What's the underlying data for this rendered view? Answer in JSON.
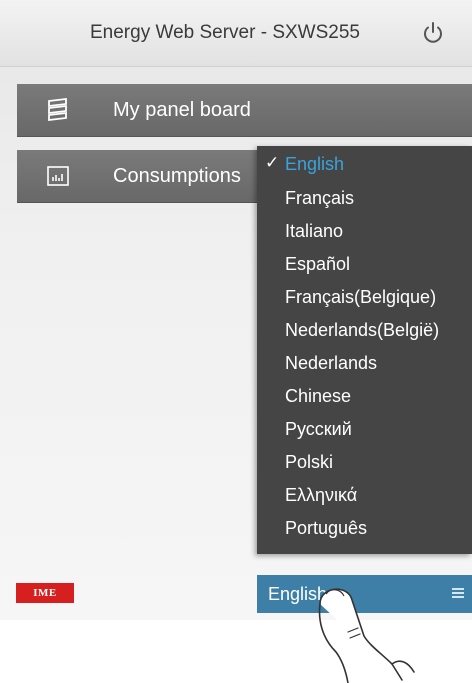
{
  "header": {
    "title": "Energy Web Server - SXWS255",
    "power_icon": "power-icon"
  },
  "menu": {
    "items": [
      {
        "label": "My panel board",
        "icon": "panel-board-icon"
      },
      {
        "label": "Consumptions",
        "icon": "bar-chart-icon"
      }
    ]
  },
  "language_menu": {
    "options": [
      {
        "label": "English",
        "selected": true
      },
      {
        "label": "Français"
      },
      {
        "label": "Italiano"
      },
      {
        "label": "Español"
      },
      {
        "label": "Français(Belgique)"
      },
      {
        "label": "Nederlands(België)"
      },
      {
        "label": "Nederlands"
      },
      {
        "label": "Chinese"
      },
      {
        "label": "Русский"
      },
      {
        "label": "Polski"
      },
      {
        "label": "Ελληνικά"
      },
      {
        "label": "Português"
      }
    ],
    "selected_color": "#3aa3dc",
    "background": "#454545"
  },
  "footer": {
    "logo_text": "IME",
    "logo_color": "#d6201f",
    "language_select": {
      "value": "English",
      "background": "#3d7fa6"
    }
  }
}
